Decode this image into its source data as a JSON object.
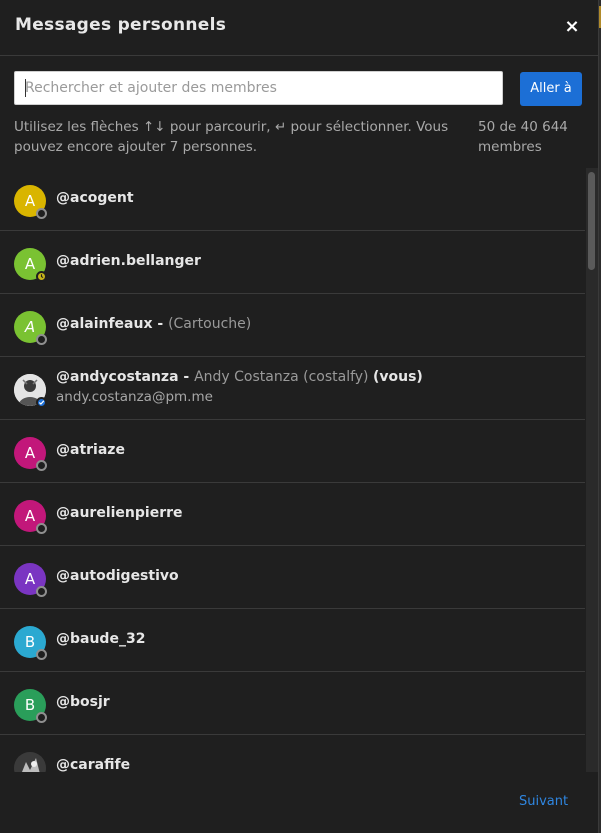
{
  "header": {
    "title": "Messages personnels",
    "close_label": "×"
  },
  "search": {
    "placeholder": "Rechercher et ajouter des membres",
    "value": "",
    "go_label": "Aller à"
  },
  "help_text": "Utilisez les flèches ↑↓ pour parcourir, ↵ pour sélectionner. Vous pouvez encore ajouter 7 personnes.",
  "count_text": "50 de 40 644 membres",
  "colors": {
    "accent": "#1c6fd6",
    "avatar_yellow": "#d9b500",
    "avatar_lime": "#7ac232",
    "avatar_magenta": "#c2177a",
    "avatar_purple": "#7a35c2",
    "avatar_cyan": "#2ba9d1",
    "avatar_green": "#2a9e5a"
  },
  "members": [
    {
      "username": "@acogent",
      "initial": "A",
      "avatar_color": "#d9b500",
      "status": "offline"
    },
    {
      "username": "@adrien.bellanger",
      "initial": "A",
      "avatar_color": "#7ac232",
      "status": "away"
    },
    {
      "username": "@alainfeaux",
      "dash": " - ",
      "nickname": "(Cartouche)",
      "initial": "A",
      "avatar_color": "#7ac232",
      "status": "offline"
    },
    {
      "username": "@andycostanza",
      "dash": " - ",
      "nickname": "Andy Costanza (costalfy)",
      "you": "(vous)",
      "email": "andy.costanza@pm.me",
      "avatar": "photo",
      "status": "verified"
    },
    {
      "username": "@atriaze",
      "initial": "A",
      "avatar_color": "#c2177a",
      "status": "offline"
    },
    {
      "username": "@aurelienpierre",
      "initial": "A",
      "avatar_color": "#c2177a",
      "status": "offline"
    },
    {
      "username": "@autodigestivo",
      "initial": "A",
      "avatar_color": "#7a35c2",
      "status": "offline"
    },
    {
      "username": "@baude_32",
      "initial": "B",
      "avatar_color": "#2ba9d1",
      "status": "offline"
    },
    {
      "username": "@bosjr",
      "initial": "B",
      "avatar_color": "#2a9e5a",
      "status": "offline"
    },
    {
      "username": "@carafife",
      "avatar": "photo",
      "status": "none"
    }
  ],
  "footer": {
    "next_label": "Suivant"
  }
}
